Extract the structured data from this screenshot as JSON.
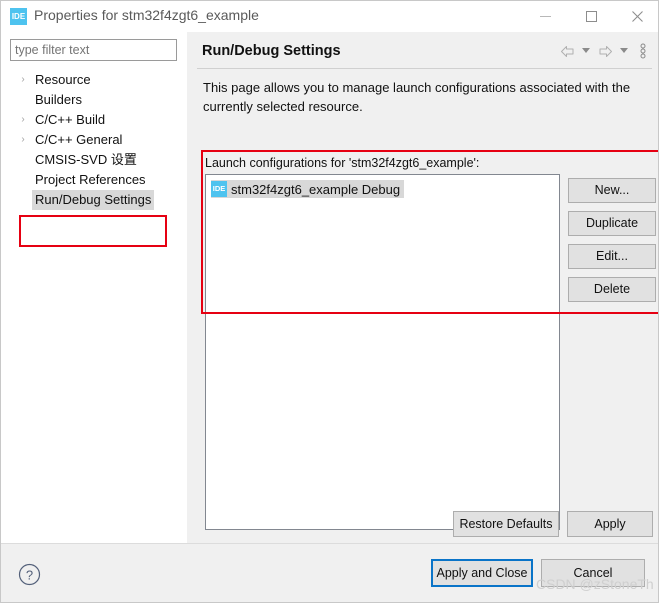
{
  "window": {
    "title": "Properties for stm32f4zgt6_example",
    "icon_label": "IDE",
    "minimize_label": "Minimize",
    "maximize_label": "Maximize",
    "close_label": "Close"
  },
  "sidebar": {
    "filter": {
      "value": "",
      "placeholder": "type filter text"
    },
    "items": [
      {
        "label": "Resource",
        "arrow": "›",
        "selected": false
      },
      {
        "label": "Builders",
        "arrow": "",
        "selected": false
      },
      {
        "label": "C/C++ Build",
        "arrow": "›",
        "selected": false
      },
      {
        "label": "C/C++ General",
        "arrow": "›",
        "selected": false
      },
      {
        "label": "CMSIS-SVD 设置",
        "arrow": "",
        "selected": false
      },
      {
        "label": "Project References",
        "arrow": "",
        "selected": false
      },
      {
        "label": "Run/Debug Settings",
        "arrow": "",
        "selected": true
      }
    ]
  },
  "content": {
    "title": "Run/Debug Settings",
    "description": "This page allows you to manage launch configurations associated with the currently selected resource.",
    "group_label": "Launch configurations for 'stm32f4zgt6_example':",
    "launch_configs": [
      {
        "label": "stm32f4zgt6_example Debug",
        "icon_label": "IDE",
        "selected": true
      }
    ],
    "side_buttons": [
      {
        "label": "New..."
      },
      {
        "label": "Duplicate"
      },
      {
        "label": "Edit..."
      },
      {
        "label": "Delete"
      }
    ],
    "restore_defaults_label": "Restore Defaults",
    "apply_label": "Apply",
    "toolbar": {
      "back_label": "Back",
      "back_menu_label": "Back history",
      "forward_label": "Forward",
      "forward_menu_label": "Forward history",
      "more_label": "View Menu"
    }
  },
  "footer": {
    "help_label": "?",
    "apply_and_close_label": "Apply and Close",
    "cancel_label": "Cancel"
  },
  "watermark": "CSDN @zStoneTh",
  "colors": {
    "accent": "#0a74c8",
    "annotation": "#e60012",
    "icon_blue": "#4ec3ef",
    "selection": "#d8d8d8"
  }
}
